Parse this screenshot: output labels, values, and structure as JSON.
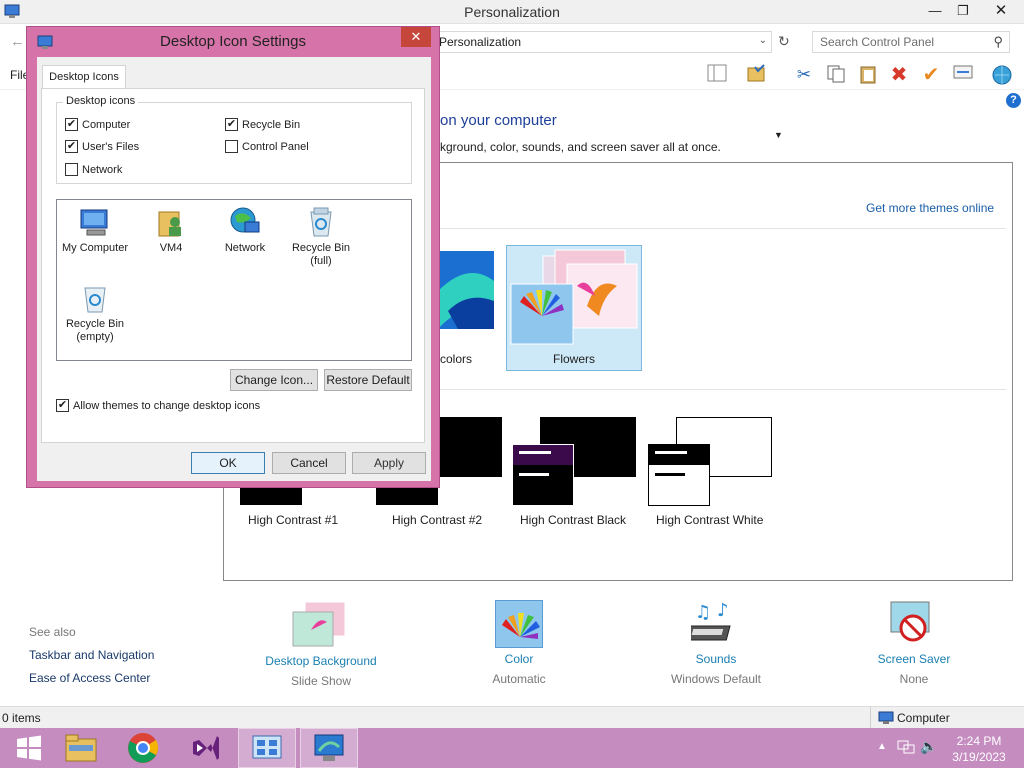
{
  "window": {
    "title": "Personalization",
    "address": "Personalization",
    "search_placeholder": "Search Control Panel",
    "menu_file": "File",
    "heading": "on your computer",
    "subheading": "kground, color, sounds, and screen saver all at once.",
    "get_more_themes": "Get more themes online",
    "themes": [
      {
        "label": "d colors"
      },
      {
        "label": "Flowers"
      }
    ],
    "high_contrast": [
      {
        "label": "High Contrast #1"
      },
      {
        "label": "High Contrast #2"
      },
      {
        "label": "High Contrast Black"
      },
      {
        "label": "High Contrast White"
      }
    ],
    "see_also": {
      "title": "See also",
      "links": [
        "Taskbar and Navigation",
        "Ease of Access Center"
      ]
    },
    "bottom_items": [
      {
        "label": "Desktop Background",
        "sub": "Slide Show"
      },
      {
        "label": "Color",
        "sub": "Automatic"
      },
      {
        "label": "Sounds",
        "sub": "Windows Default"
      },
      {
        "label": "Screen Saver",
        "sub": "None"
      }
    ],
    "status_left": "0 items",
    "status_right": "Computer"
  },
  "dialog": {
    "title": "Desktop Icon Settings",
    "tab": "Desktop Icons",
    "group_title": "Desktop icons",
    "checkboxes": [
      {
        "label": "Computer",
        "checked": true
      },
      {
        "label": "Recycle Bin",
        "checked": true
      },
      {
        "label": "User's Files",
        "checked": true
      },
      {
        "label": "Control Panel",
        "checked": false
      },
      {
        "label": "Network",
        "checked": false
      }
    ],
    "icons": [
      {
        "label": "My Computer"
      },
      {
        "label": "VM4"
      },
      {
        "label": "Network"
      },
      {
        "label": "Recycle Bin (full)"
      },
      {
        "label": "Recycle Bin (empty)"
      }
    ],
    "change_icon": "Change Icon...",
    "restore_default": "Restore Default",
    "allow_themes": "Allow themes to change desktop icons",
    "allow_themes_checked": true,
    "ok": "OK",
    "cancel": "Cancel",
    "apply": "Apply"
  },
  "taskbar": {
    "time": "2:24 PM",
    "date": "3/19/2023"
  },
  "colors": {
    "dialog_frame": "#d673a8",
    "taskbar": "#c58cc0",
    "link": "#1a5ea8"
  }
}
